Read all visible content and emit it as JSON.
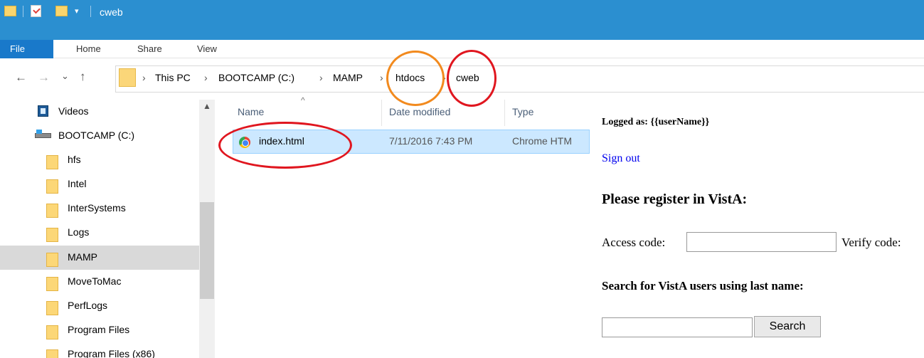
{
  "window": {
    "title": "cweb",
    "quick_access_dropdown": "▾"
  },
  "ribbon": {
    "tabs": [
      "File",
      "Home",
      "Share",
      "View"
    ]
  },
  "nav": {
    "back": "←",
    "forward": "→",
    "recent": "⌄",
    "up": "↑"
  },
  "breadcrumb": {
    "items": [
      "This PC",
      "BOOTCAMP (C:)",
      "MAMP",
      "htdocs",
      "cweb"
    ],
    "separator": "›"
  },
  "navigation_pane": {
    "items": [
      {
        "label": "Videos",
        "icon": "video-icon"
      },
      {
        "label": "BOOTCAMP (C:)",
        "icon": "drive-icon"
      },
      {
        "label": "hfs",
        "icon": "folder-icon"
      },
      {
        "label": "Intel",
        "icon": "folder-icon"
      },
      {
        "label": "InterSystems",
        "icon": "folder-icon"
      },
      {
        "label": "Logs",
        "icon": "folder-icon"
      },
      {
        "label": "MAMP",
        "icon": "folder-icon",
        "selected": true
      },
      {
        "label": "MoveToMac",
        "icon": "folder-icon"
      },
      {
        "label": "PerfLogs",
        "icon": "folder-icon"
      },
      {
        "label": "Program Files",
        "icon": "folder-icon"
      },
      {
        "label": "Program Files (x86)",
        "icon": "folder-icon"
      }
    ]
  },
  "file_list": {
    "columns": {
      "name": "Name",
      "date": "Date modified",
      "type": "Type"
    },
    "sort_indicator": "^",
    "rows": [
      {
        "name": "index.html",
        "date": "7/11/2016 7:43 PM",
        "type": "Chrome HTM",
        "icon": "chrome-icon"
      }
    ]
  },
  "web_page": {
    "logged_as": "Logged as: {{userName}}",
    "sign_out": "Sign out",
    "register_heading": "Please register in VistA:",
    "access_code_label": "Access code:",
    "verify_code_label": "Verify code:",
    "search_heading": "Search for VistA users using last name:",
    "search_button": "Search",
    "link_color": "#0000ee"
  },
  "annotations": {
    "orange_color": "#f28a1e",
    "red_color": "#e0161f"
  },
  "colors": {
    "titlebar": "#2b8fd0",
    "file_tab": "#1979ca",
    "selected_row": "#cce8ff",
    "selected_nav": "#d9d9d9"
  }
}
